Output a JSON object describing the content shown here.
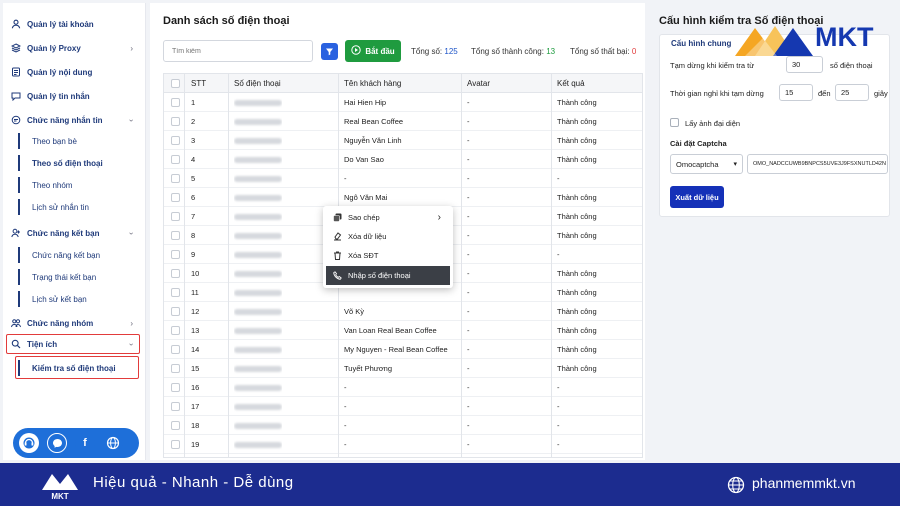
{
  "colors": {
    "accent": "#2a62e0",
    "success": "#1f9b3f",
    "brand": "#1c2c8f",
    "highlight": "#e23b3b"
  },
  "sidebar": {
    "items": [
      {
        "label": "Quản lý tài khoản",
        "icon": "user-icon",
        "chevron": false
      },
      {
        "label": "Quản lý Proxy",
        "icon": "proxy-icon",
        "chevron": true
      },
      {
        "label": "Quản lý nội dung",
        "icon": "content-icon",
        "chevron": false
      },
      {
        "label": "Quản lý tin nhắn",
        "icon": "message-icon",
        "chevron": false
      },
      {
        "label": "Chức năng nhắn tin",
        "icon": "chat-icon",
        "chevron": true
      },
      {
        "label": "Chức năng kết bạn",
        "icon": "add-friend-icon",
        "chevron": true
      },
      {
        "label": "Chức năng nhóm",
        "icon": "group-icon",
        "chevron": true
      },
      {
        "label": "Tiện ích",
        "icon": "search-icon",
        "chevron": true
      }
    ],
    "messaging_sub": [
      "Theo bạn bè",
      "Theo số điện thoại",
      "Theo nhóm",
      "Lịch sử nhắn tin"
    ],
    "friend_sub": [
      "Chức năng kết bạn",
      "Trạng thái kết bạn",
      "Lịch sử kết bạn"
    ],
    "utility_sub": [
      "Kiểm tra số điện thoại"
    ]
  },
  "main": {
    "title": "Danh sách số điện thoại",
    "search_placeholder": "Tìm kiếm",
    "start_label": "Bắt đầu",
    "stats": {
      "total_label": "Tổng số:",
      "total_value": "125",
      "success_label": "Tổng số thành công:",
      "success_value": "13",
      "fail_label": "Tổng số thất bại:",
      "fail_value": "0"
    },
    "columns": [
      "STT",
      "Số điện thoại",
      "Tên khách hàng",
      "Avatar",
      "Kết quả"
    ],
    "rows": [
      {
        "stt": "1",
        "name": "Hai Hien Hip",
        "avatar": "-",
        "result": "Thành công"
      },
      {
        "stt": "2",
        "name": "Real Bean Coffee",
        "avatar": "-",
        "result": "Thành công"
      },
      {
        "stt": "3",
        "name": "Nguyễn Văn Linh",
        "avatar": "-",
        "result": "Thành công"
      },
      {
        "stt": "4",
        "name": "Do Van Sao",
        "avatar": "-",
        "result": "Thành công"
      },
      {
        "stt": "5",
        "name": "-",
        "avatar": "-",
        "result": "-"
      },
      {
        "stt": "6",
        "name": "Ngô Văn Mai",
        "avatar": "-",
        "result": "Thành công"
      },
      {
        "stt": "7",
        "name": "",
        "avatar": "-",
        "result": "Thành công"
      },
      {
        "stt": "8",
        "name": "",
        "avatar": "-",
        "result": "Thành công"
      },
      {
        "stt": "9",
        "name": "",
        "avatar": "-",
        "result": "-"
      },
      {
        "stt": "10",
        "name": "",
        "avatar": "-",
        "result": "Thành công"
      },
      {
        "stt": "11",
        "name": "",
        "avatar": "-",
        "result": "Thành công"
      },
      {
        "stt": "12",
        "name": "Võ Kỳ",
        "avatar": "-",
        "result": "Thành công"
      },
      {
        "stt": "13",
        "name": "Van Loan Real Bean Coffee",
        "avatar": "-",
        "result": "Thành công"
      },
      {
        "stt": "14",
        "name": "My Nguyen - Real Bean Coffee",
        "avatar": "-",
        "result": "Thành công"
      },
      {
        "stt": "15",
        "name": "Tuyết Phương",
        "avatar": "-",
        "result": "Thành công"
      },
      {
        "stt": "16",
        "name": "-",
        "avatar": "-",
        "result": "-"
      },
      {
        "stt": "17",
        "name": "-",
        "avatar": "-",
        "result": "-"
      },
      {
        "stt": "18",
        "name": "-",
        "avatar": "-",
        "result": "-"
      },
      {
        "stt": "19",
        "name": "-",
        "avatar": "-",
        "result": "-"
      }
    ],
    "context_menu": [
      {
        "label": "Sao chép",
        "icon": "copy-icon",
        "submenu": true
      },
      {
        "label": "Xóa dữ liệu",
        "icon": "erase-icon",
        "submenu": false
      },
      {
        "label": "Xóa SĐT",
        "icon": "trash-icon",
        "submenu": false
      },
      {
        "label": "Nhập số điện thoại",
        "icon": "phone-icon",
        "submenu": false
      }
    ]
  },
  "config": {
    "title": "Cấu hình kiểm tra Số điện thoại",
    "tab": "Cấu hình chung",
    "pause_label": "Tạm dừng khi kiểm tra từ",
    "pause_value": "30",
    "pause_unit": "số điện thoại",
    "rest_label": "Thời gian nghỉ khi tạm dừng",
    "rest_from": "15",
    "rest_to_label": "đến",
    "rest_to": "25",
    "rest_unit": "giây",
    "avatar_label": "Lấy ảnh đại diện",
    "captcha_label": "Cài đặt Captcha",
    "captcha_service": "Omocaptcha",
    "captcha_key": "OMO_NADCCUWB9BNPCS5UVE3J9FSXNUTLD42N",
    "export_label": "Xuất dữ liệu"
  },
  "brand": {
    "logo_text": "MKT",
    "tagline": "Hiệu quả - Nhanh - Dễ dùng",
    "website": "phanmemmkt.vn"
  }
}
